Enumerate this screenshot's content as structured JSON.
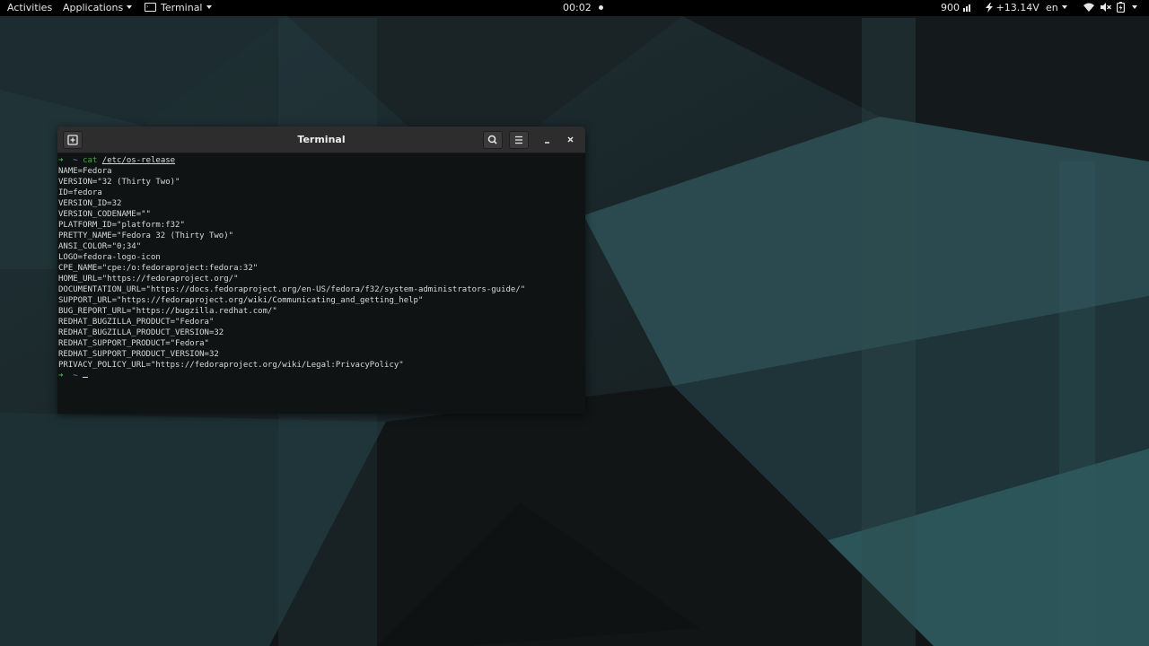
{
  "topbar": {
    "activities": "Activities",
    "applications": "Applications",
    "app_menu": "Terminal",
    "clock": "00:02",
    "cpu_freq": "900",
    "voltage": "+13.14V",
    "lang": "en",
    "icons": [
      "chart-icon",
      "power-icon",
      "wifi-icon",
      "volume-mute-icon",
      "battery-icon"
    ]
  },
  "terminal": {
    "title": "Terminal",
    "prompt_arrow": "➜",
    "prompt_tilde": "~",
    "command": "cat",
    "command_arg": "/etc/os-release",
    "output": [
      "NAME=Fedora",
      "VERSION=\"32 (Thirty Two)\"",
      "ID=fedora",
      "VERSION_ID=32",
      "VERSION_CODENAME=\"\"",
      "PLATFORM_ID=\"platform:f32\"",
      "PRETTY_NAME=\"Fedora 32 (Thirty Two)\"",
      "ANSI_COLOR=\"0;34\"",
      "LOGO=fedora-logo-icon",
      "CPE_NAME=\"cpe:/o:fedoraproject:fedora:32\"",
      "HOME_URL=\"https://fedoraproject.org/\"",
      "DOCUMENTATION_URL=\"https://docs.fedoraproject.org/en-US/fedora/f32/system-administrators-guide/\"",
      "SUPPORT_URL=\"https://fedoraproject.org/wiki/Communicating_and_getting_help\"",
      "BUG_REPORT_URL=\"https://bugzilla.redhat.com/\"",
      "REDHAT_BUGZILLA_PRODUCT=\"Fedora\"",
      "REDHAT_BUGZILLA_PRODUCT_VERSION=32",
      "REDHAT_SUPPORT_PRODUCT=\"Fedora\"",
      "REDHAT_SUPPORT_PRODUCT_VERSION=32",
      "PRIVACY_POLICY_URL=\"https://fedoraproject.org/wiki/Legal:PrivacyPolicy\""
    ]
  },
  "colors": {
    "topbar_bg": "#000000",
    "terminal_bg": "#101314",
    "header_bg": "#2d2d2d",
    "prompt_green": "#3fb950",
    "wallpaper_teal": "#2c5a5e"
  }
}
